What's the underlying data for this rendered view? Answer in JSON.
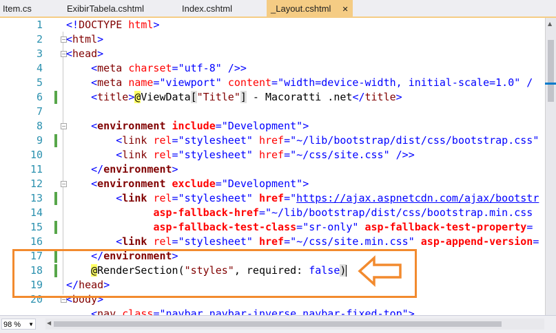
{
  "tabs": [
    {
      "label": "Item.cs",
      "active": false
    },
    {
      "label": "ExibirTabela.cshtml",
      "active": false
    },
    {
      "label": "Index.cshtml",
      "active": false
    },
    {
      "label": "_Layout.cshtml",
      "active": true
    }
  ],
  "active_tab_close": "✕",
  "line_numbers": [
    "1",
    "2",
    "3",
    "4",
    "5",
    "6",
    "7",
    "8",
    "9",
    "10",
    "11",
    "12",
    "13",
    "14",
    "15",
    "16",
    "17",
    "18",
    "19",
    "20"
  ],
  "code": {
    "l1": {
      "lt": "<!",
      "tag": "DOCTYPE",
      "attr": " html",
      "gt": ">"
    },
    "l2": {
      "text": "html"
    },
    "l3": {
      "text": "head"
    },
    "l4": {
      "tag": "meta",
      "attr": "charset",
      "val": "\"utf-8\"",
      "end": " />"
    },
    "l5": {
      "tag": "meta",
      "attr1": "name",
      "val1": "\"viewport\"",
      "attr2": "content",
      "val2": "\"width=device-width, initial-scale=1.0\"",
      "end": " /"
    },
    "l6": {
      "tag": "title",
      "at": "@",
      "expr": "ViewData",
      "open": "[",
      "key": "\"Title\"",
      "close": "]",
      "rest": " - Macoratti .net",
      "endtag": "title"
    },
    "l8": {
      "tag": "environment",
      "attr": "include",
      "val": "\"Development\""
    },
    "l9": {
      "tag": "link",
      "attr1": "rel",
      "val1": "\"stylesheet\"",
      "attr2": "href",
      "val2": "\"~/lib/bootstrap/dist/css/bootstrap.css\""
    },
    "l10": {
      "tag": "link",
      "attr1": "rel",
      "val1": "\"stylesheet\"",
      "attr2": "href",
      "val2": "\"~/css/site.css\"",
      "end": " />"
    },
    "l11": {
      "tag": "environment"
    },
    "l12": {
      "tag": "environment",
      "attr": "exclude",
      "val": "\"Development\""
    },
    "l13": {
      "tag": "link",
      "attr1": "rel",
      "val1": "\"stylesheet\"",
      "attr2": "href",
      "q": "\"",
      "url": "https://ajax.aspnetcdn.com/ajax/bootstr"
    },
    "l14": {
      "attr": "asp-fallback-href",
      "val": "\"~/lib/bootstrap/dist/css/bootstrap.min.css"
    },
    "l15": {
      "attr1": "asp-fallback-test-class",
      "val1": "\"sr-only\"",
      "attr2": "asp-fallback-test-property",
      "eq": "="
    },
    "l16": {
      "tag": "link",
      "attr1": "rel",
      "val1": "\"stylesheet\"",
      "attr2": "href",
      "val2": "\"~/css/site.min.css\"",
      "attr3": "asp-append-version",
      "eq": "="
    },
    "l17": {
      "tag": "environment"
    },
    "l18": {
      "at": "@",
      "expr": "RenderSection",
      "open": "(",
      "arg1": "\"styles\"",
      "sep": ", required: ",
      "kw": "false",
      "close": ")"
    },
    "l19": {
      "tag": "head"
    },
    "l20": {
      "tag": "body"
    },
    "l21": {
      "tag": "nav",
      "attr": "class",
      "val": "\"navbar navbar-inverse navbar-fixed-top\"",
      "end": ">"
    }
  },
  "zoom": "98 %",
  "colors": {
    "highlight_box": "#f28a2e",
    "active_tab": "#f5cc84",
    "line_number": "#2b91af",
    "change_mark": "#57a64a"
  }
}
